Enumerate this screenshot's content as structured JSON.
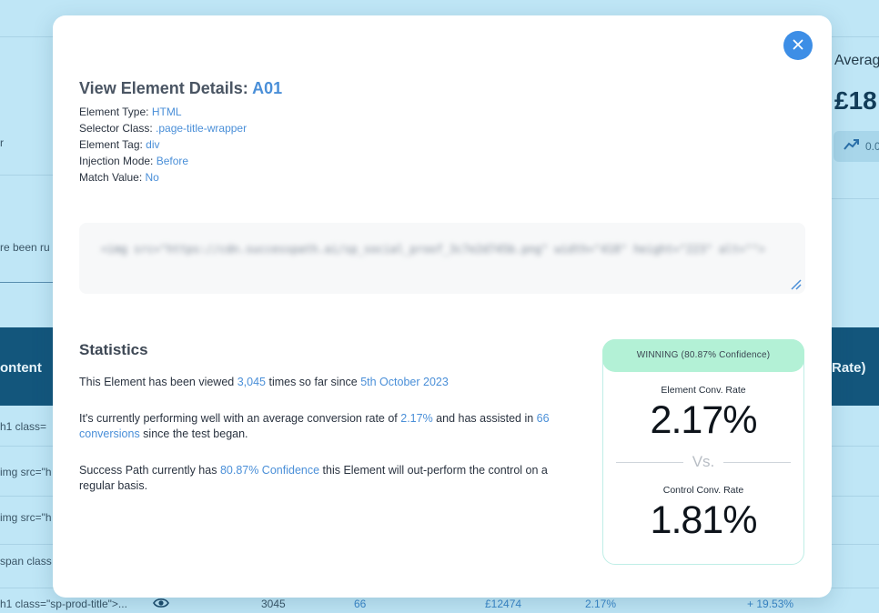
{
  "background": {
    "avg_label": "Averag",
    "avg_value": "£18",
    "trend_value": "0.0",
    "left_fragments": {
      "f1": "r",
      "f2": "re been ru"
    },
    "table_header": {
      "content": "ontent",
      "rate": "Rate)"
    },
    "rows": [
      "h1 class=",
      "img src=\"h",
      "img src=\"h",
      "span class"
    ],
    "last_row": {
      "content": "h1 class=\"sp-prod-title\">...",
      "views": "3045",
      "conversions": "66",
      "revenue": "£12474",
      "rate": "2.17%",
      "uplift": "+ 19.53%"
    }
  },
  "modal": {
    "title_prefix": "View Element Details: ",
    "title_id": "A01",
    "details": {
      "type_label": "Element Type: ",
      "type_value": "HTML",
      "selector_label": "Selector Class: ",
      "selector_value": ".page-title-wrapper",
      "tag_label": "Element Tag: ",
      "tag_value": "div",
      "injection_label": "Injection Mode: ",
      "injection_value": "Before",
      "match_label": "Match Value: ",
      "match_value": "No"
    },
    "code_snippet": "<img src=\"https://cdn.successpath.ai/sp_social_proof_3c7e2d745b.png\" width=\"418\" height=\"223\" alt=\"\">",
    "statistics": {
      "heading": "Statistics",
      "p1_a": "This Element has been viewed ",
      "p1_views": "3,045",
      "p1_b": " times so far since ",
      "p1_date": "5th October 2023",
      "p2_a": "It's currently performing well with an average conversion rate of ",
      "p2_rate": "2.17%",
      "p2_b": " and has assisted in ",
      "p2_conv": "66 conversions",
      "p2_c": " since the test began.",
      "p3_a": "Success Path currently has ",
      "p3_conf": "80.87% Confidence",
      "p3_b": " this Element will out-perform the control on a regular basis."
    },
    "card": {
      "banner": "WINNING (80.87% Confidence)",
      "element_label": "Element Conv. Rate",
      "element_value": "2.17%",
      "vs": "Vs.",
      "control_label": "Control Conv. Rate",
      "control_value": "1.81%"
    }
  },
  "colors": {
    "accent": "#4a8fd8",
    "close_button": "#3d8ee6",
    "winning_banner": "#b3f1d6",
    "backdrop": "#bfe6f6"
  }
}
